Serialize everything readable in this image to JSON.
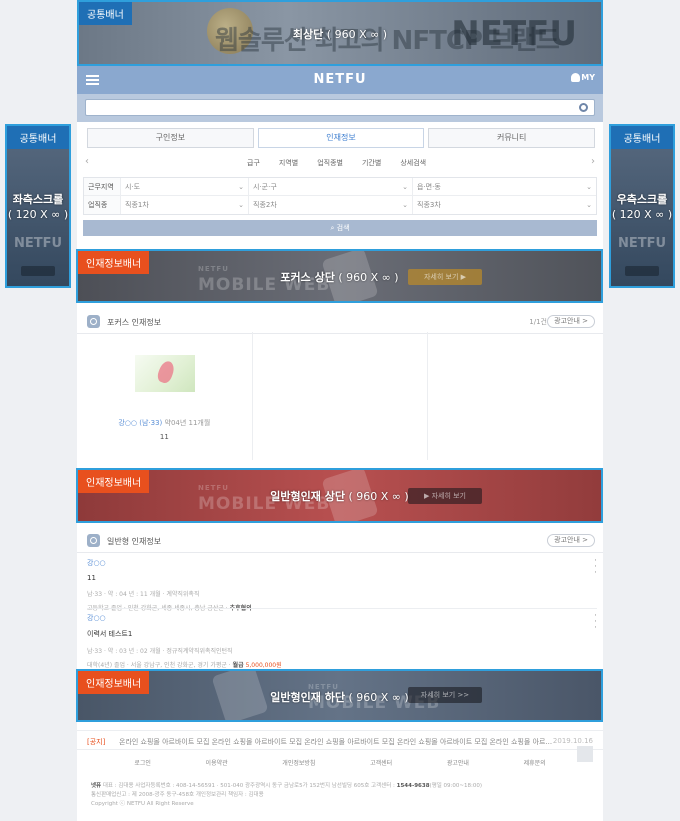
{
  "banners": {
    "top": {
      "tag": "공통배너",
      "label": "최상단",
      "size": "( 960 X ∞ )",
      "watermark_left": "웹솔루션",
      "watermark_mid": "최고의 NFTCP 브랜드",
      "watermark_right": "NETFU"
    },
    "left": {
      "tag": "공통배너",
      "label": "좌측스크롤",
      "size": "( 120 X ∞ )",
      "watermark": "NETFU"
    },
    "right": {
      "tag": "공통배너",
      "label": "우측스크롤",
      "size": "( 120 X ∞ )",
      "watermark": "NETFU"
    },
    "focus": {
      "tag": "인재정보배너",
      "label": "포커스 상단",
      "size": "( 960 X ∞ )",
      "watermark": "MOBILE WEB",
      "watermark_small": "NETFU",
      "watermark_btn": "자세히 보기 ▶"
    },
    "general_top": {
      "tag": "인재정보배너",
      "label": "일반형인재 상단",
      "size": "( 960 X ∞ )",
      "watermark": "MOBILE WEB",
      "watermark_small": "NETFU",
      "watermark_btn": "▶ 자세히 보기"
    },
    "general_bottom": {
      "tag": "인재정보배너",
      "label": "일반형인재 하단",
      "size": "( 960 X ∞ )",
      "watermark": "MOBILE WEB",
      "watermark_small": "NETFU",
      "watermark_btn": "자세히 보기 >>"
    }
  },
  "header": {
    "logo": "NETFU",
    "my": "MY"
  },
  "search": {
    "placeholder": ""
  },
  "tabs": [
    {
      "label": "구인정보"
    },
    {
      "label": "인재정보"
    },
    {
      "label": "커뮤니티"
    }
  ],
  "subnav": [
    "급구",
    "지역별",
    "업직종별",
    "기간별",
    "상세검색"
  ],
  "filters": {
    "row1": {
      "label": "근무지역",
      "sel1": "시·도",
      "sel2": "시·군·구",
      "sel3": "읍·면·동"
    },
    "row2": {
      "label": "업직종",
      "sel1": "직종1차",
      "sel2": "직종2차",
      "sel3": "직종3차"
    },
    "search_button": "검색"
  },
  "focus_section": {
    "title": "포커스 인재정보",
    "count": "1/1건",
    "ad_button": "광고안내 >",
    "item": {
      "name": "강○○",
      "meta": "(남·33)",
      "exp": "약04년 11개월",
      "num": "11"
    }
  },
  "general_section": {
    "title": "일반형 인재정보",
    "ad_button": "광고안내 >",
    "items": [
      {
        "name": "강○○",
        "title": "11",
        "meta1": "남·33 · 약 : 04 년 : 11 개월 · 계약직위촉직",
        "meta2a": "고등학교 졸업 · 인천 강화군, 세종 세종시, 충남 금산군 · ",
        "meta2b": "추후협의",
        "pay": ""
      },
      {
        "name": "강○○",
        "title": "이력서 테스트1",
        "meta1": "남·33 · 약 : 03 년 : 02 개월 · 정규직계약직위촉직인턴직",
        "meta2a": "대학(4년) 졸업 · 서울 강남구, 인천 강화군, 경기 가평군 · ",
        "meta2b": "월급",
        "pay": "5,000,000원"
      }
    ]
  },
  "notice": {
    "label": "[공지]",
    "text": "온라인 쇼핑몰 아르바이트 모집 온라인 쇼핑몰 아르바이트 모집 온라인 쇼핑몰 아르바이트 모집 온라인 쇼핑몰 아르바이트 모집 온라인 쇼핑몰 아르...",
    "date": "2019.10.16"
  },
  "footer_nav": [
    "로그인",
    "이용약관",
    "개인정보방침",
    "고객센터",
    "광고안내",
    "제휴문의"
  ],
  "footer_info": {
    "line1a": "넷퓨",
    "line1b": " 대표 : 김대용  사업자등록번호 : 408-14-56591 · 501-040 광주광역시 동구 금남로5가 152번지 남선빌딩 605호  고객센터 : ",
    "phone": "1544-9638",
    "line1c": "(평일 09:00~18:00)",
    "line2": "통신판매업신고 : 제 2008-광주 동구-458호  개인정보관리 책임자 : 김대용",
    "line3": "Copyright ⓒ NETFU All Right Reserve"
  }
}
